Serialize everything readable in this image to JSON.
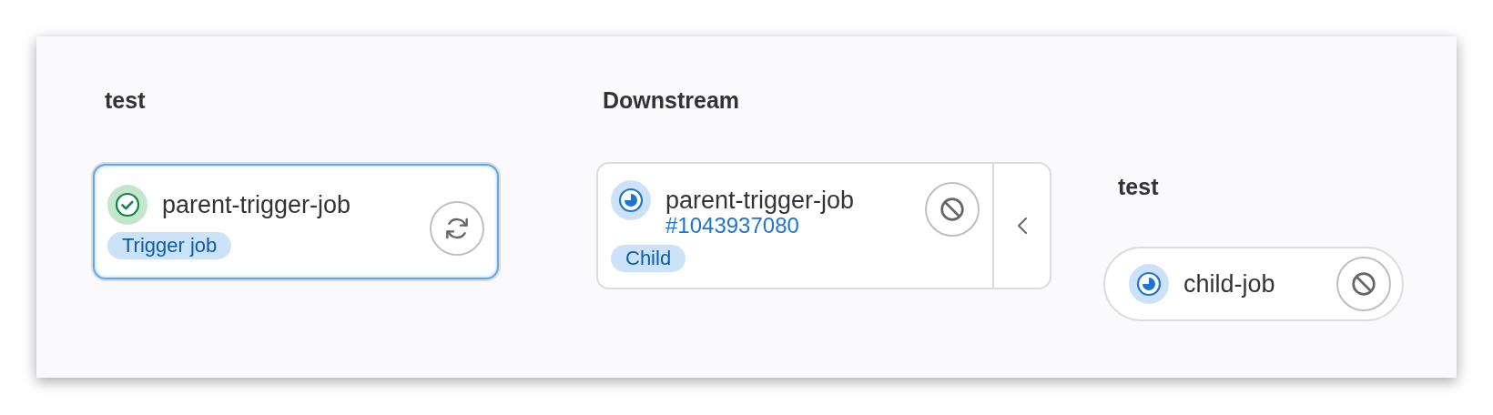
{
  "columns": [
    {
      "title": "test",
      "kind": "stage",
      "jobs": [
        {
          "name": "parent-trigger-job",
          "status": {
            "kind": "success"
          },
          "badge": "Trigger job",
          "action": {
            "kind": "retry"
          },
          "selected": true
        }
      ]
    },
    {
      "title": "Downstream",
      "kind": "downstream",
      "jobs": [
        {
          "name": "parent-trigger-job",
          "link": "#1043937080",
          "status": {
            "kind": "running"
          },
          "badge": "Child",
          "action": {
            "kind": "cancel"
          },
          "selected": false,
          "expanded": true
        }
      ]
    },
    {
      "title": "test",
      "kind": "child",
      "jobs": [
        {
          "name": "child-job",
          "status": {
            "kind": "running"
          },
          "action": {
            "kind": "cancel"
          },
          "selected": false
        }
      ]
    }
  ]
}
